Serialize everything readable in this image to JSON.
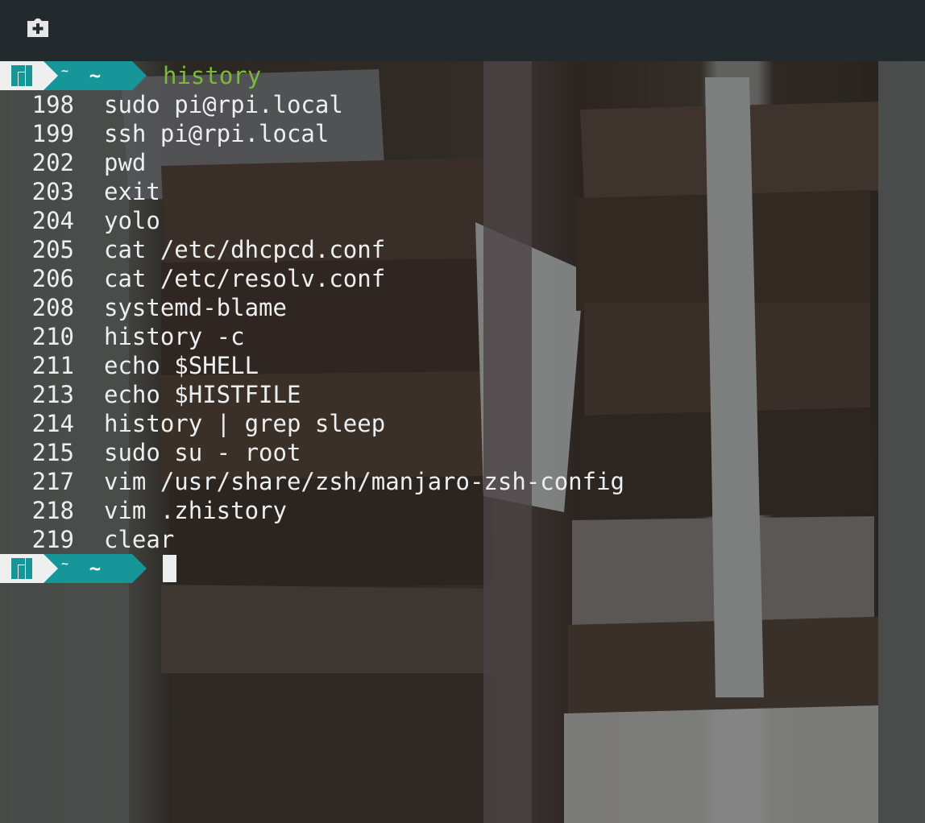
{
  "toolbar": {
    "new_tab_icon": "new-tab-icon"
  },
  "prompt": {
    "logo_icon": "manjaro-logo-icon",
    "small_tilde": "~",
    "dir": "~",
    "command": "history",
    "accent_color": "#17969a",
    "command_color": "#7eb83b"
  },
  "history": [
    {
      "num": "198",
      "cmd": "sudo pi@rpi.local"
    },
    {
      "num": "199",
      "cmd": "ssh pi@rpi.local"
    },
    {
      "num": "202",
      "cmd": "pwd"
    },
    {
      "num": "203",
      "cmd": "exit"
    },
    {
      "num": "204",
      "cmd": "yolo"
    },
    {
      "num": "205",
      "cmd": "cat /etc/dhcpcd.conf"
    },
    {
      "num": "206",
      "cmd": "cat /etc/resolv.conf"
    },
    {
      "num": "208",
      "cmd": "systemd-blame"
    },
    {
      "num": "210",
      "cmd": "history -c"
    },
    {
      "num": "211",
      "cmd": "echo $SHELL"
    },
    {
      "num": "213",
      "cmd": "echo $HISTFILE"
    },
    {
      "num": "214",
      "cmd": "history | grep sleep"
    },
    {
      "num": "215",
      "cmd": "sudo su - root"
    },
    {
      "num": "217",
      "cmd": "vim /usr/share/zsh/manjaro-zsh-config"
    },
    {
      "num": "218",
      "cmd": "vim .zhistory"
    },
    {
      "num": "219",
      "cmd": "clear"
    }
  ]
}
